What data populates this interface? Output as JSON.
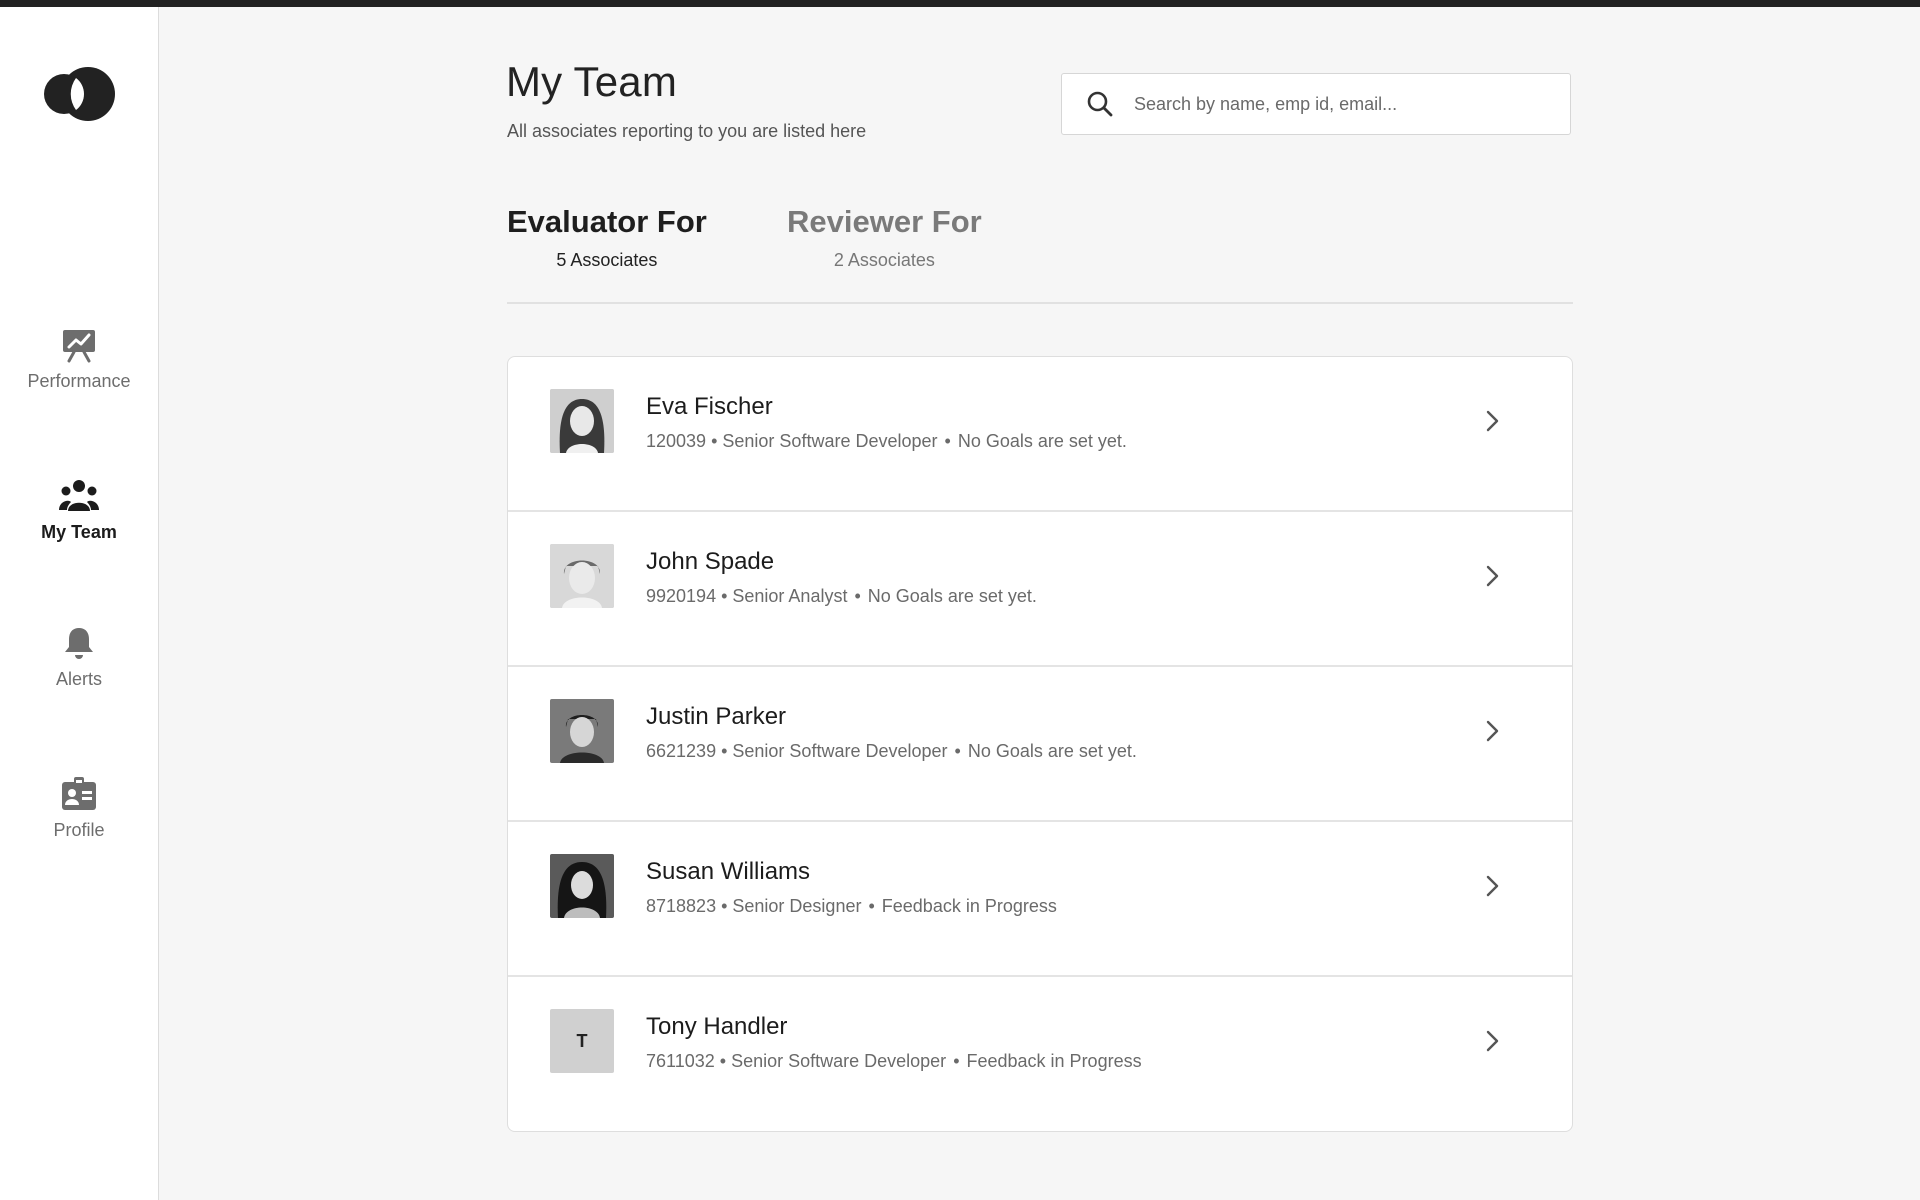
{
  "nav": {
    "items": [
      {
        "label": "Performance",
        "icon": "performance-icon",
        "active": false
      },
      {
        "label": "My Team",
        "icon": "team-icon",
        "active": true
      },
      {
        "label": "Alerts",
        "icon": "bell-icon",
        "active": false
      },
      {
        "label": "Profile",
        "icon": "id-badge-icon",
        "active": false
      }
    ]
  },
  "header": {
    "title": "My Team",
    "subtitle": "All associates reporting to you are listed here"
  },
  "search": {
    "placeholder": "Search by name, emp id, email..."
  },
  "tabs": [
    {
      "title": "Evaluator For",
      "count": "5 Associates",
      "active": true
    },
    {
      "title": "Reviewer For",
      "count": "2 Associates",
      "active": false
    }
  ],
  "associates": [
    {
      "name": "Eva Fischer",
      "emp_id": "120039",
      "role": "Senior Software Developer",
      "status": "No Goals are set yet.",
      "avatar": "photo"
    },
    {
      "name": "John Spade",
      "emp_id": "9920194",
      "role": "Senior Analyst",
      "status": "No Goals are set yet.",
      "avatar": "photo"
    },
    {
      "name": "Justin Parker",
      "emp_id": "6621239",
      "role": "Senior Software Developer",
      "status": "No Goals are set yet.",
      "avatar": "photo"
    },
    {
      "name": "Susan Williams",
      "emp_id": "8718823",
      "role": "Senior Designer",
      "status": "Feedback in Progress",
      "avatar": "photo"
    },
    {
      "name": "Tony Handler",
      "emp_id": "7611032",
      "role": "Senior Software Developer",
      "status": "Feedback in Progress",
      "avatar": "T"
    }
  ],
  "colors": {
    "background": "#f6f6f6",
    "sidebar": "#ffffff",
    "text_primary": "#1f1f1f",
    "text_muted": "#6a6a6a",
    "topbar": "#222222"
  }
}
